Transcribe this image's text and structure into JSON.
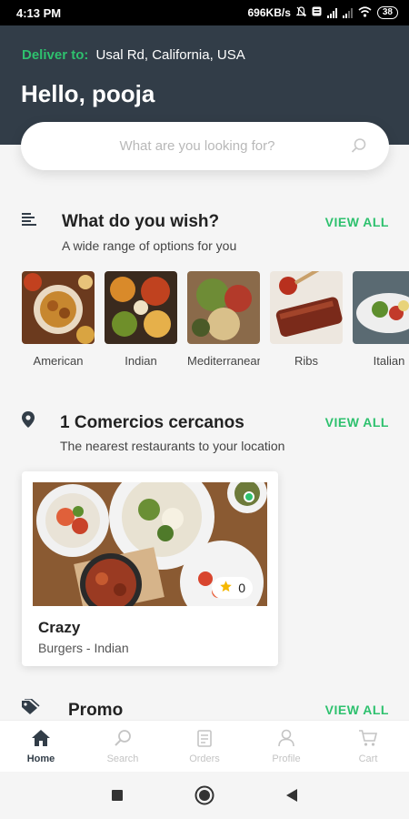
{
  "status_bar": {
    "time": "4:13 PM",
    "speed": "696KB/s",
    "battery": "38"
  },
  "header": {
    "deliver_label": "Deliver to:",
    "address": "Usal Rd, California, USA",
    "greeting": "Hello, pooja"
  },
  "search": {
    "placeholder": "What are you looking for?"
  },
  "wish_section": {
    "title": "What do you wish?",
    "subtitle": "A wide range of options for you",
    "view_all": "VIEW ALL",
    "categories": [
      {
        "label": "American"
      },
      {
        "label": "Indian"
      },
      {
        "label": "Mediterranean"
      },
      {
        "label": "Ribs"
      },
      {
        "label": "Italian"
      }
    ]
  },
  "nearby_section": {
    "title": "1 Comercios cercanos",
    "subtitle": "The nearest restaurants to your location",
    "view_all": "VIEW ALL",
    "restaurant": {
      "name": "Crazy",
      "tags": "Burgers - Indian",
      "rating": "0"
    }
  },
  "promo_section": {
    "title": "Promo",
    "view_all": "VIEW ALL"
  },
  "bottom_nav": [
    {
      "label": "Home",
      "icon": "home-icon",
      "active": true
    },
    {
      "label": "Search",
      "icon": "search-icon"
    },
    {
      "label": "Orders",
      "icon": "orders-icon"
    },
    {
      "label": "Profile",
      "icon": "profile-icon"
    },
    {
      "label": "Cart",
      "icon": "cart-icon"
    }
  ],
  "colors": {
    "accent": "#2ec16e",
    "header_bg": "#323d48"
  }
}
